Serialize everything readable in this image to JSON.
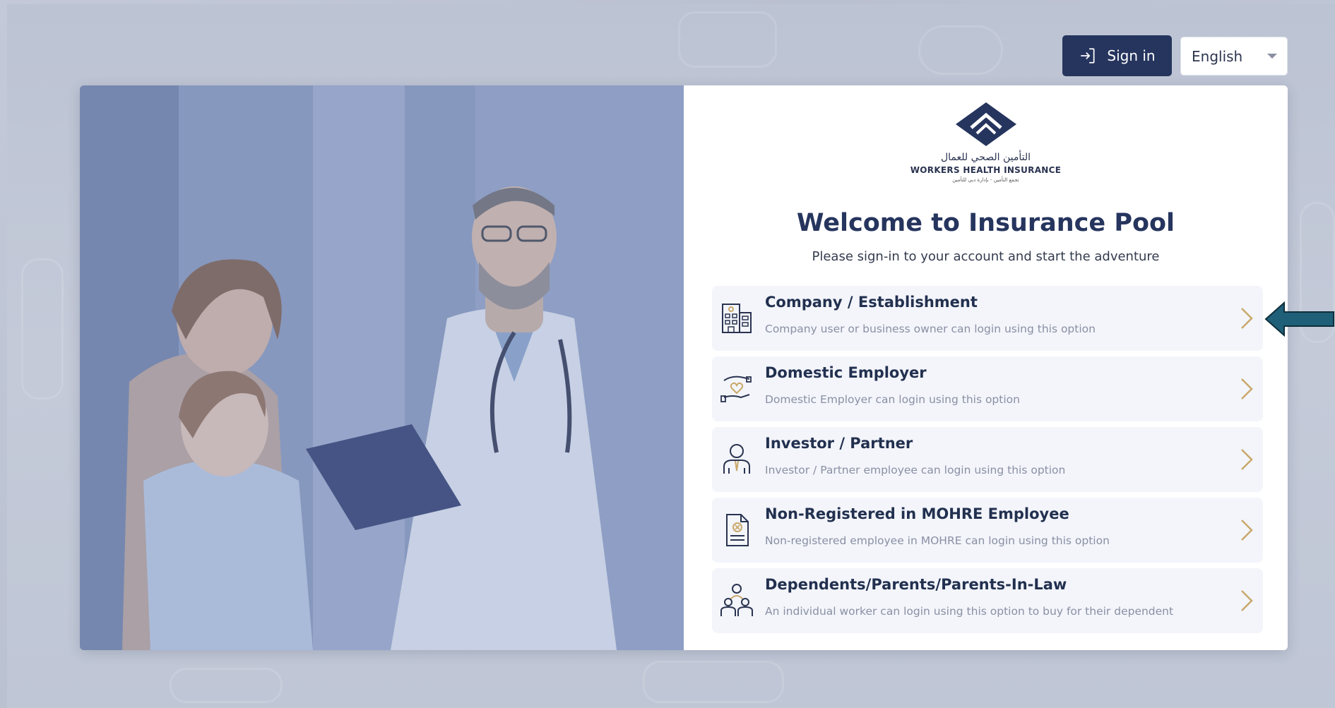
{
  "topbar": {
    "signin_label": "Sign in",
    "language_selected": "English"
  },
  "logo": {
    "arabic_text": "التأمين الصحي للعمال",
    "english_text": "WORKERS HEALTH INSURANCE",
    "sub_text": "تجمع التأمين - بإدارة دبي للتأمين"
  },
  "panel": {
    "title": "Welcome to Insurance Pool",
    "subtitle": "Please sign-in to your account and start the adventure"
  },
  "options": [
    {
      "title": "Company / Establishment",
      "desc": "Company user or business owner can login using this option",
      "icon": "building-icon"
    },
    {
      "title": "Domestic Employer",
      "desc": "Domestic Employer can login using this option",
      "icon": "hand-heart-icon"
    },
    {
      "title": "Investor / Partner",
      "desc": "Investor / Partner employee can login using this option",
      "icon": "businessman-icon"
    },
    {
      "title": "Non-Registered in MOHRE Employee",
      "desc": "Non-registered employee in MOHRE can login using this option",
      "icon": "document-cancel-icon"
    },
    {
      "title": "Dependents/Parents/Parents-In-Law",
      "desc": "An individual worker can login using this option to buy for their dependent",
      "icon": "family-group-icon"
    }
  ],
  "colors": {
    "navy": "#26355e",
    "accent_gold": "#c9a86a",
    "arrow_teal": "#1f5f78"
  }
}
